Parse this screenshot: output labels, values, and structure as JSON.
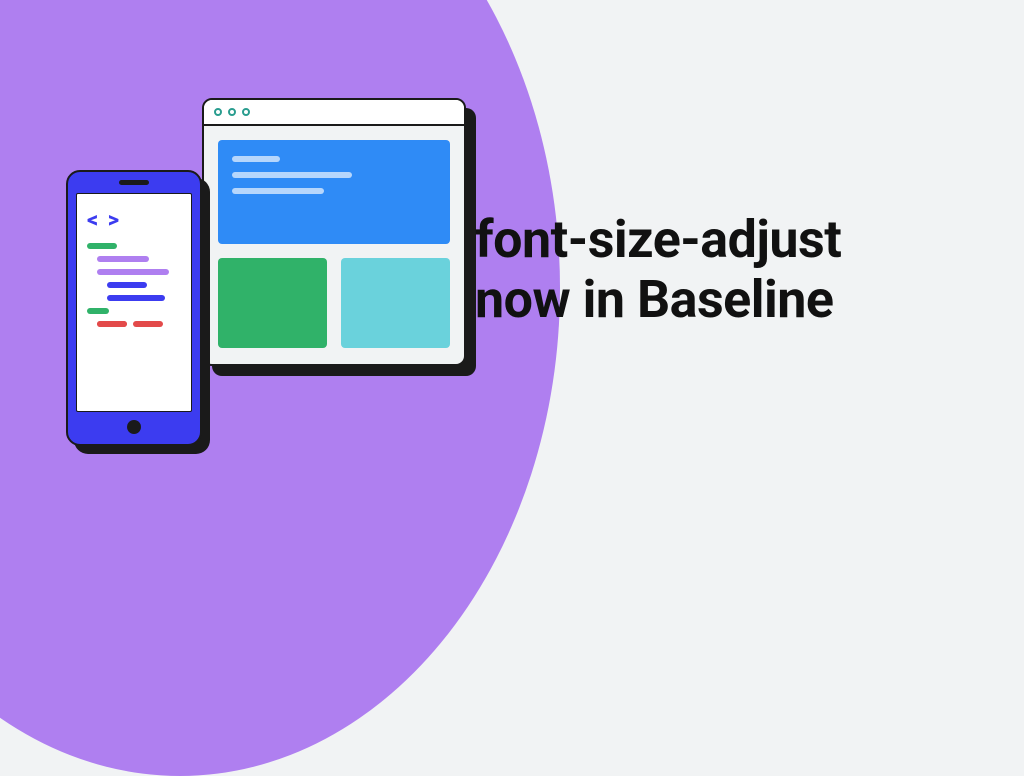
{
  "headline": {
    "line1": "font-size-adjust",
    "line2": "now in Baseline"
  },
  "illustration": {
    "code_icon": "< >"
  }
}
